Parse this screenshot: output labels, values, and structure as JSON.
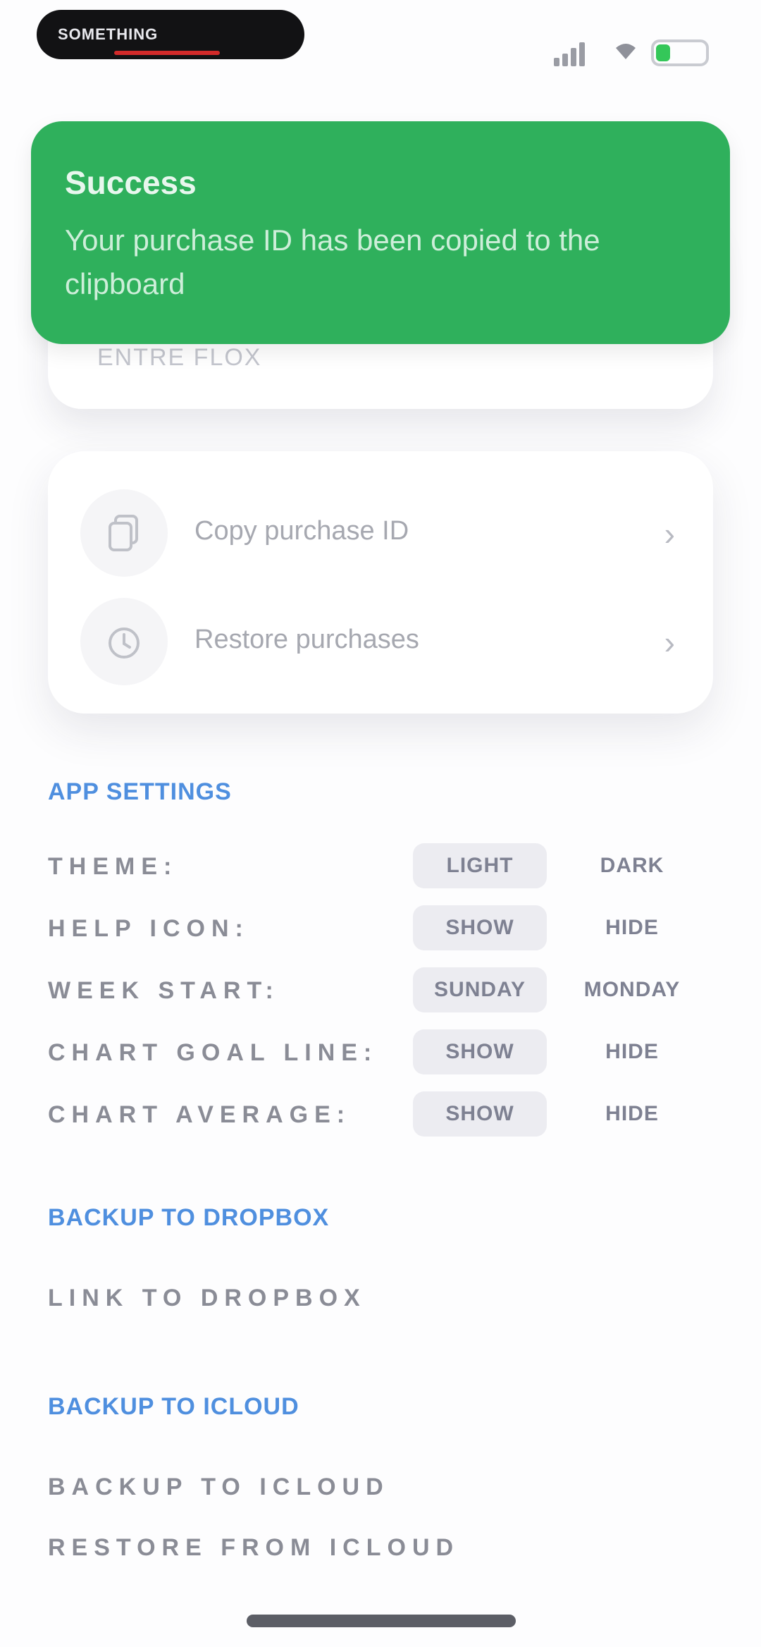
{
  "status_bar": {
    "island_text": "SOMETHING",
    "wifi_icon": "wifi-icon",
    "signal_icon": "signal-icon",
    "battery_icon": "battery-icon",
    "battery_level": 0.3,
    "battery_color": "#34c759"
  },
  "toast": {
    "title": "Success",
    "message": "Your purchase ID has been copied to the clipboard",
    "color": "#2fb05c"
  },
  "card_top": {
    "text": "ENTRE FLOX"
  },
  "actions": [
    {
      "label": "Copy purchase ID",
      "icon": "copy-icon"
    },
    {
      "label": "Restore purchases",
      "icon": "restore-icon"
    }
  ],
  "app_settings": {
    "title": "APP SETTINGS",
    "rows": [
      {
        "label": "THEME:",
        "options": [
          "LIGHT",
          "DARK"
        ],
        "selected": 0
      },
      {
        "label": "HELP ICON:",
        "options": [
          "SHOW",
          "HIDE"
        ],
        "selected": 0
      },
      {
        "label": "WEEK START:",
        "options": [
          "SUNDAY",
          "MONDAY"
        ],
        "selected": 0
      },
      {
        "label": "CHART GOAL LINE:",
        "options": [
          "SHOW",
          "HIDE"
        ],
        "selected": 0
      },
      {
        "label": "CHART AVERAGE:",
        "options": [
          "SHOW",
          "HIDE"
        ],
        "selected": 0
      }
    ]
  },
  "dropbox": {
    "title": "BACKUP TO DROPBOX",
    "link_label": "LINK TO DROPBOX"
  },
  "icloud": {
    "title": "BACKUP TO ICLOUD",
    "backup_label": "BACKUP TO ICLOUD",
    "restore_label": "RESTORE FROM ICLOUD"
  },
  "colors": {
    "accent": "#4f8fdf",
    "background": "#fdfdfe"
  }
}
